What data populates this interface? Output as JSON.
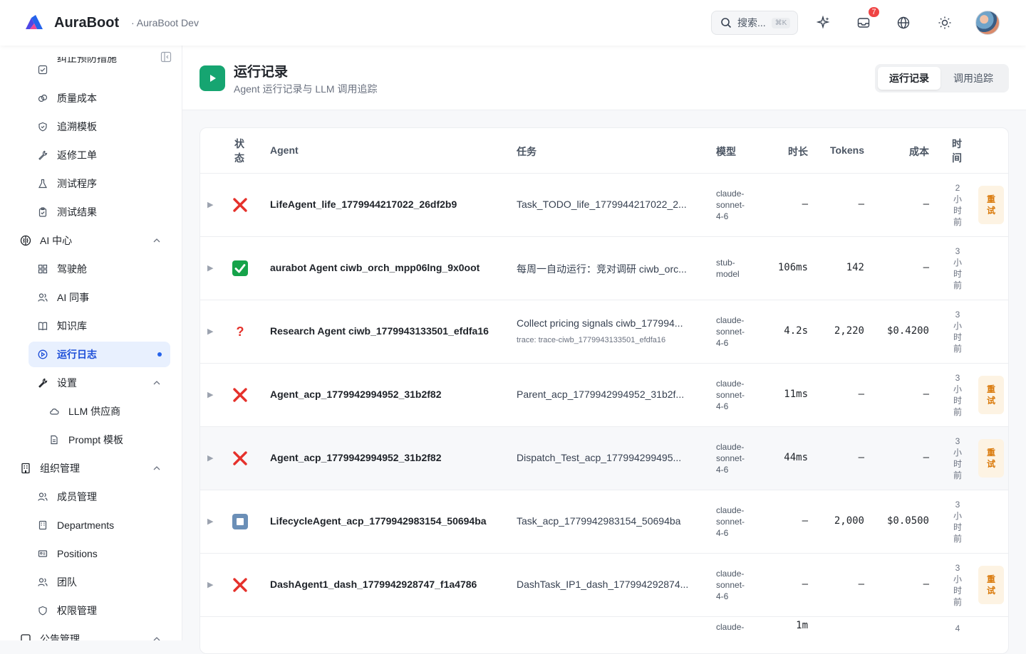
{
  "header": {
    "brand": "AuraBoot",
    "env": "· AuraBoot Dev",
    "search_placeholder": "搜索...",
    "search_kbd": "⌘K",
    "notifications_count": "7",
    "icons": [
      "sparkle-icon",
      "inbox-icon",
      "globe-icon",
      "sun-icon"
    ]
  },
  "sidebar": {
    "items_top": [
      {
        "label": "纠正预防措施",
        "icon": "checkbox-icon"
      },
      {
        "label": "质量成本",
        "icon": "coins-icon"
      },
      {
        "label": "追溯模板",
        "icon": "shield-icon"
      },
      {
        "label": "返修工单",
        "icon": "wrench-icon"
      },
      {
        "label": "测试程序",
        "icon": "flask-icon"
      },
      {
        "label": "测试结果",
        "icon": "clipboard-icon"
      }
    ],
    "group_ai": "AI 中心",
    "ai_items": [
      {
        "label": "驾驶舱",
        "icon": "dashboard-icon"
      },
      {
        "label": "AI 同事",
        "icon": "users-icon"
      },
      {
        "label": "知识库",
        "icon": "book-icon"
      },
      {
        "label": "运行日志",
        "icon": "play-circle-icon"
      }
    ],
    "settings": "设置",
    "settings_items": [
      {
        "label": "LLM 供应商",
        "icon": "cloud-icon"
      },
      {
        "label": "Prompt 模板",
        "icon": "file-icon"
      }
    ],
    "group_org": "组织管理",
    "org_items": [
      {
        "label": "成员管理",
        "icon": "users-icon"
      },
      {
        "label": "Departments",
        "icon": "building-icon"
      },
      {
        "label": "Positions",
        "icon": "id-card-icon"
      },
      {
        "label": "团队",
        "icon": "team-icon"
      },
      {
        "label": "权限管理",
        "icon": "shield-icon"
      }
    ],
    "group_notice": "公告管理"
  },
  "page": {
    "title": "运行记录",
    "subtitle": "Agent 运行记录与 LLM 调用追踪",
    "tabs": [
      "运行记录",
      "调用追踪"
    ]
  },
  "table": {
    "headers": {
      "status": "状态",
      "agent": "Agent",
      "task": "任务",
      "model": "模型",
      "duration": "时长",
      "tokens": "Tokens",
      "cost": "成本",
      "time": "时间"
    },
    "retry_label": "重试",
    "rows": [
      {
        "status": "failed",
        "status_glyph": "✕",
        "agent": "LifeAgent_life_1779944217022_26df2b9",
        "task": "Task_TODO_life_1779944217022_2...",
        "trace": "",
        "model": "claude-sonnet-4-6",
        "duration": "–",
        "tokens": "–",
        "cost": "–",
        "time": "2小时前",
        "retry": true
      },
      {
        "status": "success",
        "status_glyph": "✓",
        "agent": "aurabot Agent ciwb_orch_mpp06lng_9x0oot",
        "task": "每周一自动运行：竞对调研 ciwb_orc...",
        "trace": "",
        "model": "stub-model",
        "duration": "106ms",
        "tokens": "142",
        "cost": "–",
        "time": "3小时前",
        "retry": false
      },
      {
        "status": "unknown",
        "status_glyph": "?",
        "agent": "Research Agent ciwb_1779943133501_efdfa16",
        "task": "Collect pricing signals ciwb_177994...",
        "trace": "trace: trace-ciwb_1779943133501_efdfa16",
        "model": "claude-sonnet-4-6",
        "duration": "4.2s",
        "tokens": "2,220",
        "cost": "$0.4200",
        "time": "3小时前",
        "retry": false
      },
      {
        "status": "failed",
        "status_glyph": "✕",
        "agent": "Agent_acp_1779942994952_31b2f82",
        "task": "Parent_acp_1779942994952_31b2f...",
        "trace": "",
        "model": "claude-sonnet-4-6",
        "duration": "11ms",
        "tokens": "–",
        "cost": "–",
        "time": "3小时前",
        "retry": true
      },
      {
        "status": "failed",
        "status_glyph": "✕",
        "agent": "Agent_acp_1779942994952_31b2f82",
        "task": "Dispatch_Test_acp_177994299495...",
        "trace": "",
        "model": "claude-sonnet-4-6",
        "duration": "44ms",
        "tokens": "–",
        "cost": "–",
        "time": "3小时前",
        "retry": true
      },
      {
        "status": "stopped",
        "status_glyph": "■",
        "agent": "LifecycleAgent_acp_1779942983154_50694ba",
        "task": "Task_acp_1779942983154_50694ba",
        "trace": "",
        "model": "claude-sonnet-4-6",
        "duration": "–",
        "tokens": "2,000",
        "cost": "$0.0500",
        "time": "3小时前",
        "retry": false
      },
      {
        "status": "failed",
        "status_glyph": "✕",
        "agent": "DashAgent1_dash_1779942928747_f1a4786",
        "task": "DashTask_IP1_dash_177994292874...",
        "trace": "",
        "model": "claude-sonnet-4-6",
        "duration": "–",
        "tokens": "–",
        "cost": "–",
        "time": "3小时前",
        "retry": true
      },
      {
        "status": "partial",
        "status_glyph": "",
        "agent": "",
        "task": "",
        "trace": "",
        "model": "claude-",
        "duration": "1m",
        "tokens": "",
        "cost": "",
        "time": "4",
        "retry": false
      }
    ]
  },
  "colors": {
    "accent": "#2563eb",
    "success": "#16a571",
    "danger": "#ef4444",
    "retry_bg": "#fdf3e3",
    "retry_fg": "#d97706"
  }
}
